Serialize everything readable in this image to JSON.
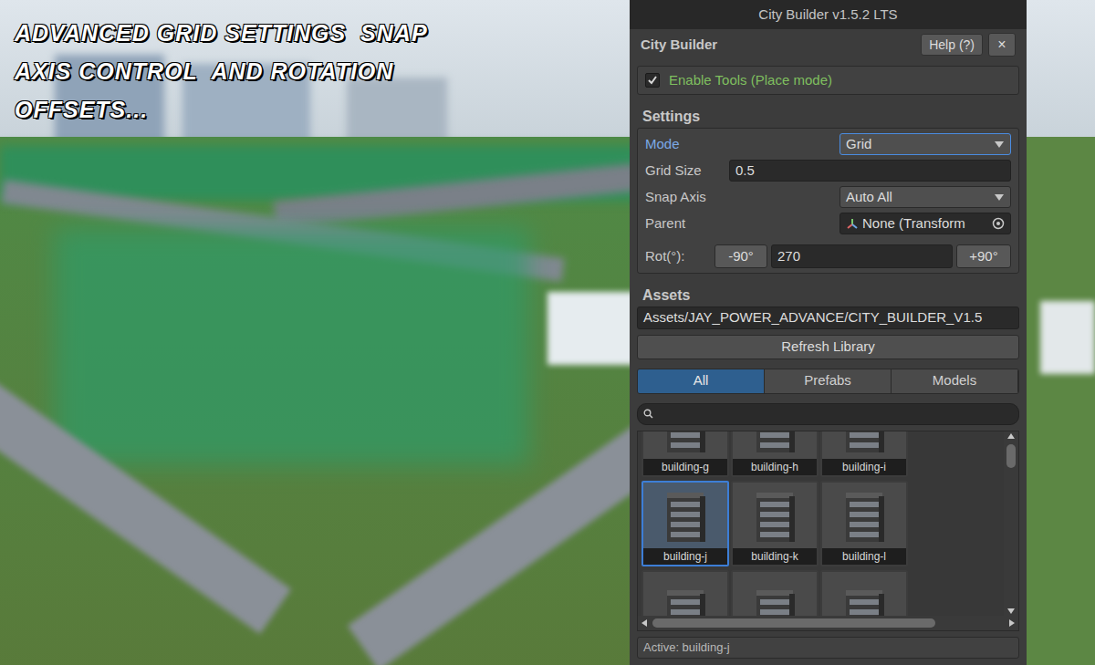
{
  "caption": {
    "lines": [
      "ADVANCED GRID SETTINGS  SNAP",
      "AXIS CONTROL  AND ROTATION",
      "OFFSETS..."
    ]
  },
  "window": {
    "title": "City Builder v1.5.2 LTS"
  },
  "header": {
    "title": "City Builder",
    "help_button": "Help (?)",
    "close_button": "×"
  },
  "enable_tools": {
    "label": "Enable Tools (Place mode)",
    "checked": true
  },
  "settings": {
    "title": "Settings",
    "mode": {
      "label": "Mode",
      "value": "Grid",
      "focused": true
    },
    "grid_size": {
      "label": "Grid Size",
      "value": "0.5"
    },
    "snap_axis": {
      "label": "Snap Axis",
      "value": "Auto All"
    },
    "parent": {
      "label": "Parent",
      "value": "None (Transform"
    },
    "rotation": {
      "label": "Rot(°):",
      "decrease": "-90°",
      "value": "270",
      "increase": "+90°"
    }
  },
  "assets": {
    "title": "Assets",
    "path": "Assets/JAY_POWER_ADVANCE/CITY_BUILDER_V1.5",
    "refresh_button": "Refresh Library",
    "tabs": [
      {
        "label": "All",
        "selected": true
      },
      {
        "label": "Prefabs",
        "selected": false
      },
      {
        "label": "Models",
        "selected": false
      }
    ],
    "search": {
      "value": ""
    },
    "tiles": [
      {
        "label": "building-g",
        "selected": false,
        "kind": "labeled"
      },
      {
        "label": "building-h",
        "selected": false,
        "kind": "labeled"
      },
      {
        "label": "building-i",
        "selected": false,
        "kind": "labeled"
      },
      {
        "label": "building-j",
        "selected": true,
        "kind": "labeled"
      },
      {
        "label": "building-k",
        "selected": false,
        "kind": "labeled"
      },
      {
        "label": "building-l",
        "selected": false,
        "kind": "labeled"
      },
      {
        "label": "",
        "selected": false,
        "kind": "cut"
      },
      {
        "label": "",
        "selected": false,
        "kind": "cut"
      },
      {
        "label": "",
        "selected": false,
        "kind": "cut"
      }
    ]
  },
  "status_bar": {
    "text": "Active: building-j"
  }
}
